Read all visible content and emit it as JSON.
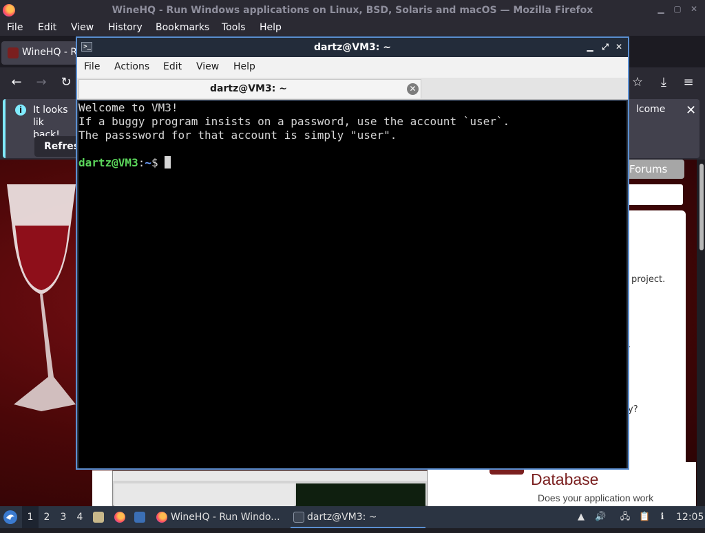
{
  "firefox": {
    "title": "WineHQ - Run Windows applications on Linux, BSD, Solaris and macOS — Mozilla Firefox",
    "menu": [
      "File",
      "Edit",
      "View",
      "History",
      "Bookmarks",
      "Tools",
      "Help"
    ],
    "tab_label": "WineHQ - Ru",
    "notice": {
      "text": "It looks lik back!",
      "text_line1": "It looks lik",
      "text_line2": "back!",
      "welcome": "lcome",
      "refresh_label": "Refresh"
    },
    "page": {
      "forums": "Forums",
      "project_text": "project.",
      "period_text": ".",
      "question_text": "y?",
      "db_title": "Database",
      "db_sub": "Does your application work"
    }
  },
  "terminal": {
    "title": "dartz@VM3: ~",
    "menu": [
      "File",
      "Actions",
      "Edit",
      "View",
      "Help"
    ],
    "tab_label": "dartz@VM3: ~",
    "lines": [
      "Welcome to VM3!",
      "If a buggy program insists on a password, use the account `user`.",
      "The passsword for that account is simply \"user\"."
    ],
    "prompt_user": "dartz@VM3",
    "prompt_sep": ":",
    "prompt_path": "~",
    "prompt_sym": "$ "
  },
  "taskbar": {
    "workspaces": [
      "1",
      "2",
      "3",
      "4"
    ],
    "tasks": [
      {
        "label": "WineHQ - Run Windo..."
      },
      {
        "label": "dartz@VM3: ~"
      }
    ],
    "clock": "12:05"
  },
  "colors": {
    "accent": "#5b8fd1",
    "prompt_green": "#5bd65b",
    "prompt_blue": "#6ea0ff",
    "wine_red": "#7a1f1f"
  }
}
